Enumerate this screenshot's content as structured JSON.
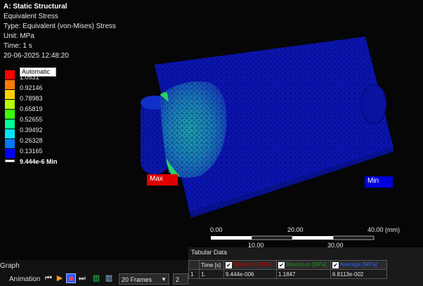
{
  "header": {
    "title": "A: Static Structural",
    "result_name": "Equivalent Stress",
    "type": "Type: Equivalent (von-Mises) Stress",
    "unit": "Unit: MPa",
    "time": "Time: 1 s",
    "timestamp": "20-06-2025 12:48:20"
  },
  "legend": {
    "mode": "Automatic",
    "values": [
      "1.0531",
      "0.92146",
      "0.78983",
      "0.65819",
      "0.52655",
      "0.39492",
      "0.26328",
      "0.13165"
    ],
    "min_label": "9.444e-6 Min",
    "colors": [
      "#ff0000",
      "#ff7a00",
      "#ffd200",
      "#b4ff00",
      "#3cff00",
      "#00ff96",
      "#00e6ff",
      "#0078ff",
      "#0000ff"
    ]
  },
  "probes": {
    "max": "Max",
    "min": "Min"
  },
  "scale_bar": {
    "top_ticks": [
      "0.00",
      "20.00",
      "40.00 (mm)"
    ],
    "bottom_ticks": [
      "10.00",
      "30.00"
    ]
  },
  "tabular": {
    "title": "Tabular Data",
    "columns": [
      "Time [s]",
      "Minimum [MPa]",
      "Maximum [MPa]",
      "Average [MPa]"
    ],
    "rows": [
      {
        "index": "1",
        "time": "1.",
        "min": "9.444e-006",
        "max": "1.1847",
        "avg": "6.8113e-002"
      }
    ]
  },
  "bottom": {
    "graph_label": "Graph",
    "animation_label": "Animation",
    "frames": "20 Frames",
    "seconds": "2 Sec"
  }
}
